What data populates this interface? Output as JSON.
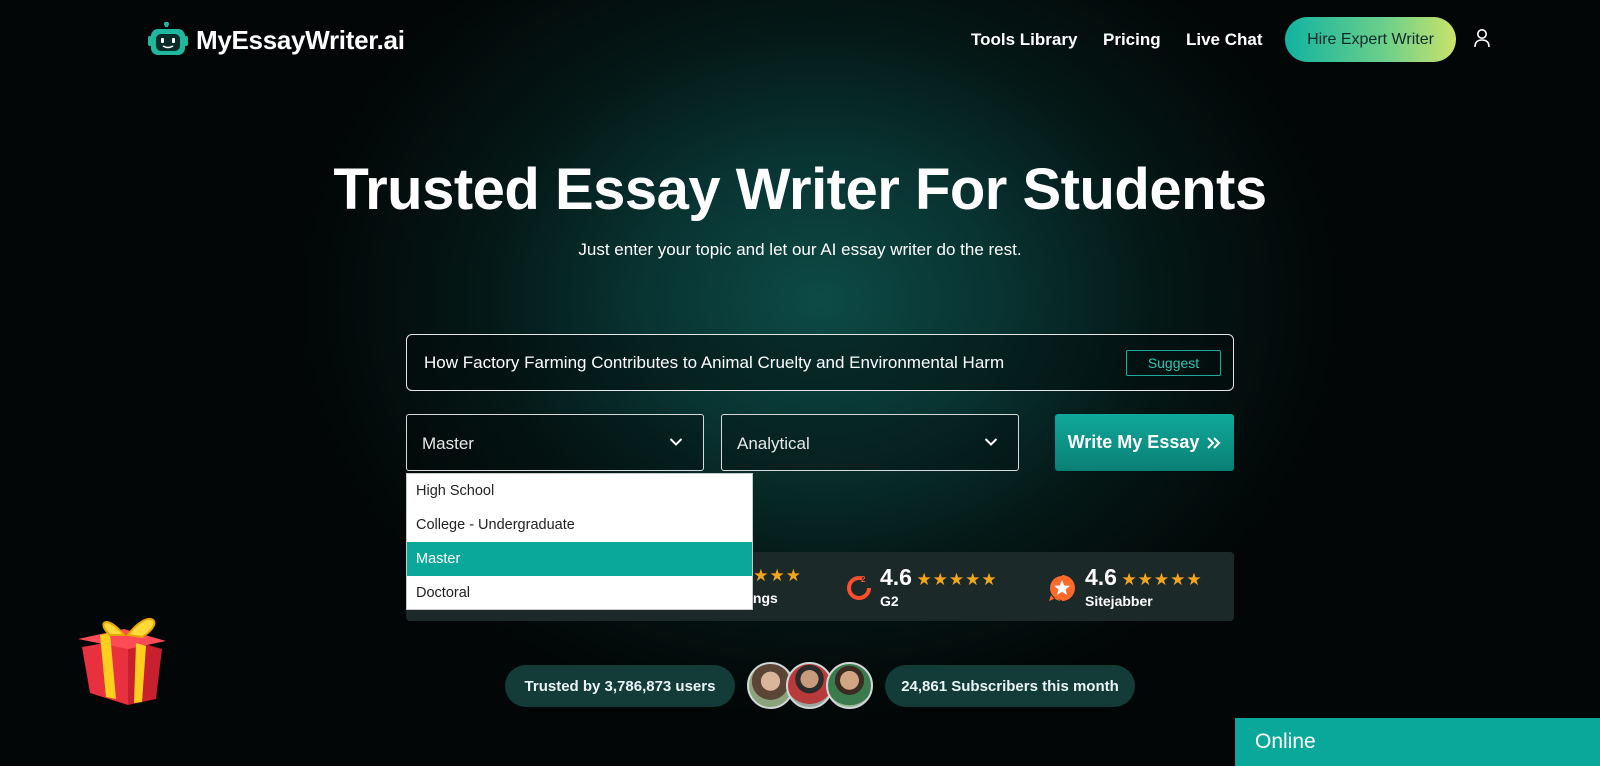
{
  "header": {
    "brand": "MyEssayWriter.ai",
    "nav": [
      {
        "label": "Tools Library"
      },
      {
        "label": "Pricing"
      },
      {
        "label": "Live Chat"
      }
    ],
    "cta_label": "Hire Expert Writer"
  },
  "hero": {
    "title": "Trusted Essay Writer For Students",
    "subtitle": "Just enter your topic and let our AI essay writer do the rest."
  },
  "form": {
    "topic_value": "How Factory Farming Contributes to Animal Cruelty and Environmental Harm",
    "suggest_label": "Suggest",
    "level_selected": "Master",
    "type_selected": "Analytical",
    "submit_label": "Write My Essay",
    "level_options": [
      "High School",
      "College - Undergraduate",
      "Master",
      "Doctoral"
    ]
  },
  "ratings": {
    "partial_label": "ings",
    "items": [
      {
        "score": "4.6",
        "name": "G2",
        "stars": "★★★★★",
        "icon": "g2-logo-icon"
      },
      {
        "score": "4.6",
        "name": "Sitejabber",
        "stars": "★★★★★",
        "icon": "sitejabber-logo-icon"
      }
    ]
  },
  "trust": {
    "users": "Trusted by 3,786,873 users",
    "subscribers": "24,861 Subscribers this month"
  },
  "chat": {
    "status": "Online"
  },
  "colors": {
    "accent": "#0aa89a",
    "star": "#f4a51c",
    "cta_gradient_start": "#10b3a0",
    "cta_gradient_end": "#c9e36a"
  }
}
